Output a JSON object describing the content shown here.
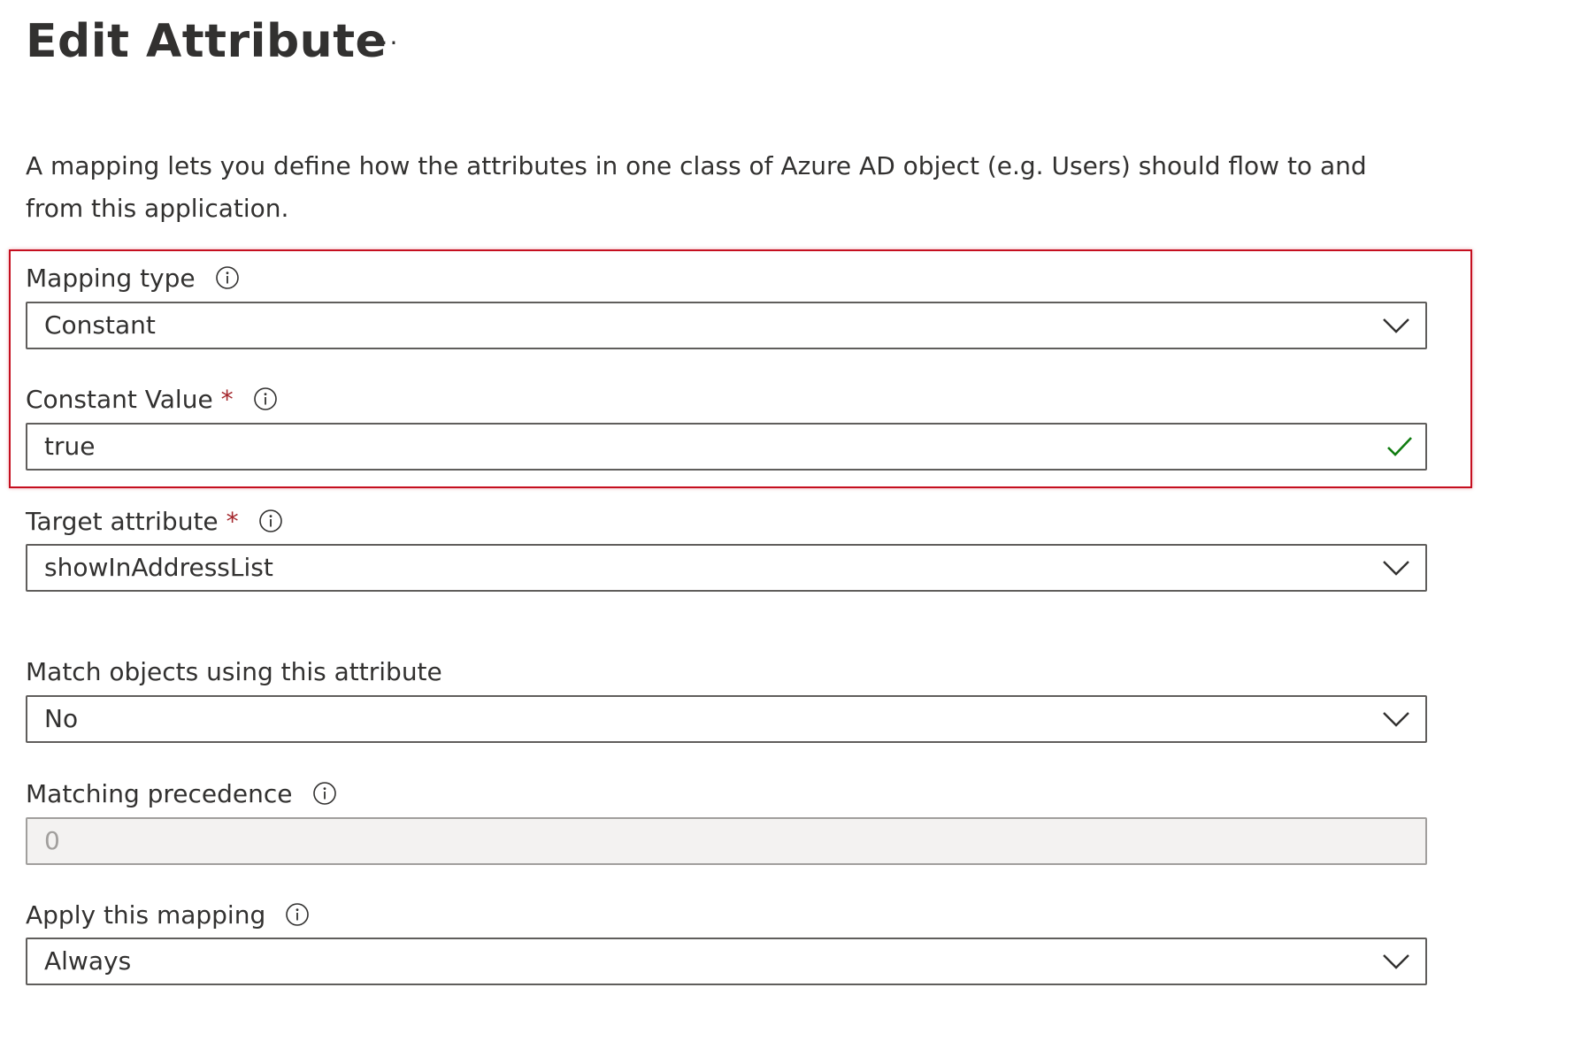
{
  "header": {
    "title": "Edit Attribute",
    "more_label": "···"
  },
  "description": "A mapping lets you define how the attributes in one class of Azure AD object (e.g. Users) should flow to and from this application.",
  "fields": {
    "mapping_type": {
      "label": "Mapping type",
      "value": "Constant"
    },
    "constant_value": {
      "label": "Constant Value",
      "required_mark": "*",
      "value": "true"
    },
    "target_attribute": {
      "label": "Target attribute",
      "required_mark": "*",
      "value": "showInAddressList"
    },
    "match_objects": {
      "label": "Match objects using this attribute",
      "value": "No"
    },
    "matching_precedence": {
      "label": "Matching precedence",
      "value": "0"
    },
    "apply_mapping": {
      "label": "Apply this mapping",
      "value": "Always"
    }
  },
  "colors": {
    "highlight_border": "#c50f1f",
    "required_star": "#a4262c",
    "valid_check": "#107c10",
    "text": "#323130",
    "field_border": "#605e5c",
    "disabled_background": "#f3f2f1"
  },
  "icons": {
    "info": "info-icon",
    "dropdown": "chevron-down-icon",
    "valid": "checkmark-icon"
  }
}
